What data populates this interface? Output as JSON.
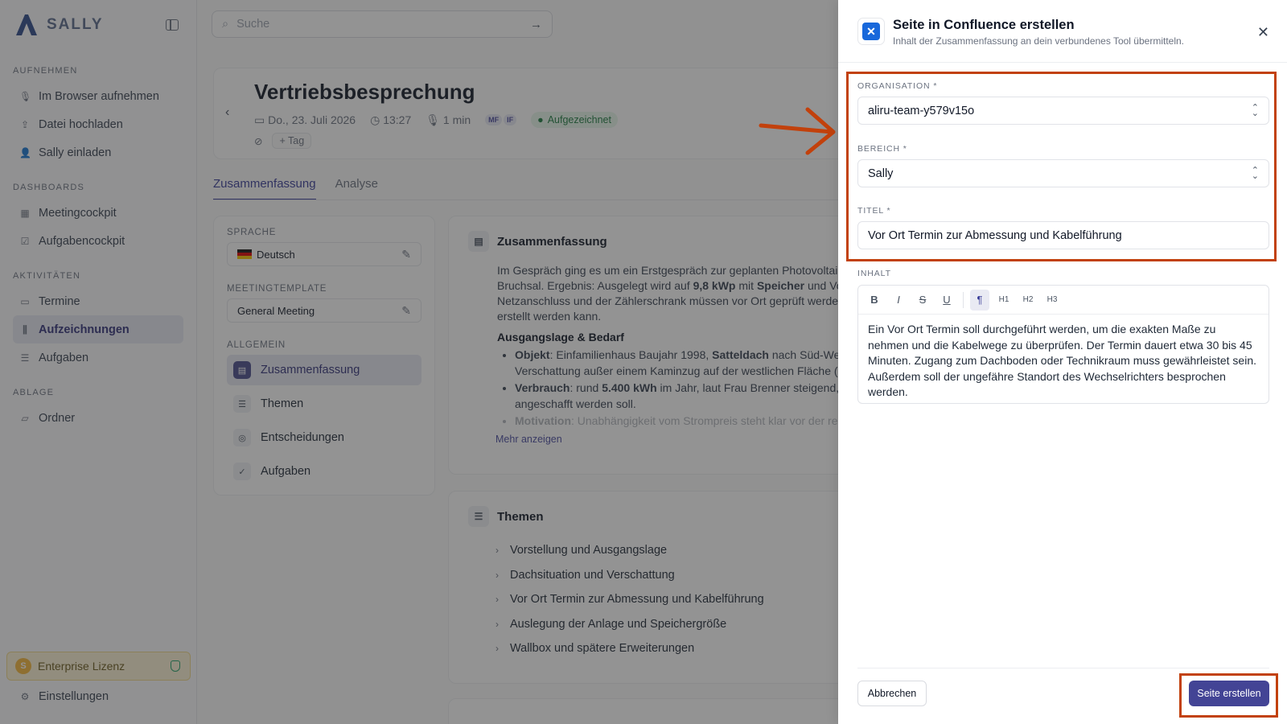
{
  "sidebar": {
    "brand": "SALLY",
    "sections": [
      {
        "title": "Aufnehmen",
        "items": [
          {
            "label": "Im Browser aufnehmen",
            "icon": "microphone-icon"
          },
          {
            "label": "Datei hochladen",
            "icon": "upload-icon"
          },
          {
            "label": "Sally einladen",
            "icon": "user-plus-icon"
          }
        ]
      },
      {
        "title": "Dashboards",
        "items": [
          {
            "label": "Meetingcockpit",
            "icon": "grid-icon"
          },
          {
            "label": "Aufgabencockpit",
            "icon": "checkbox-icon"
          }
        ]
      },
      {
        "title": "Aktivitäten",
        "items": [
          {
            "label": "Termine",
            "icon": "calendar-icon"
          },
          {
            "label": "Aufzeichnungen",
            "icon": "waveform-icon",
            "active": true
          },
          {
            "label": "Aufgaben",
            "icon": "list-check-icon"
          }
        ]
      },
      {
        "title": "Ablage",
        "items": [
          {
            "label": "Ordner",
            "icon": "folder-icon"
          }
        ]
      }
    ],
    "license_label": "Enterprise Lizenz",
    "settings_label": "Einstellungen"
  },
  "search": {
    "placeholder": "Suche"
  },
  "meeting": {
    "title": "Vertriebsbesprechung",
    "date": "Do., 23. Juli 2026",
    "time": "13:27",
    "duration": "1 min",
    "avatars": [
      "MF",
      "IF"
    ],
    "status": "Aufgezeichnet",
    "tag_button": "Tag"
  },
  "tabs": [
    "Zusammenfassung",
    "Analyse"
  ],
  "left_panel": {
    "language_label": "Sprache",
    "language_value": "Deutsch",
    "template_label": "Meetingtemplate",
    "template_value": "General Meeting",
    "general_label": "Allgemein",
    "items": [
      "Zusammenfassung",
      "Themen",
      "Entscheidungen",
      "Aufgaben"
    ]
  },
  "summary": {
    "heading": "Zusammenfassung",
    "intro_1": "Im Gespräch ging es um ein Erstgespräch zur geplanten Photovoltai",
    "intro_2a": "Bruchsal. Ergebnis: Ausgelegt wird auf ",
    "intro_2b": "9,8 kWp",
    "intro_2c": " mit ",
    "intro_2d": "Speicher",
    "intro_2e": " und Vo",
    "intro_3": "Netzanschluss und der Zählerschrank müssen vor Ort geprüft werde",
    "intro_4": "erstellt werden kann.",
    "subheading": "Ausgangslage & Bedarf",
    "b1_label": "Objekt",
    "b1_text_a": ": Einfamilienhaus Baujahr 1998, ",
    "b1_text_b": "Satteldach",
    "b1_text_c": " nach Süd-Wes",
    "b1_line2": "Verschattung außer einem Kaminzug auf der westlichen Fläche (",
    "b2_label": "Verbrauch",
    "b2_text_a": ": rund ",
    "b2_text_b": "5.400 kWh",
    "b2_text_c": " im Jahr, laut Frau Brenner steigend, ",
    "b2_line2": "angeschafft werden soll.",
    "b3_label": "Motivation",
    "b3_text": ": Unabhängigkeit vom Strompreis steht klar vor der re",
    "more": "Mehr anzeigen"
  },
  "themen": {
    "heading": "Themen",
    "items": [
      "Vorstellung und Ausgangslage",
      "Dachsituation und Verschattung",
      "Vor Ort Termin zur Abmessung und Kabelführung",
      "Auslegung der Anlage und Speichergröße",
      "Wallbox und spätere Erweiterungen"
    ]
  },
  "dialog": {
    "title": "Seite in Confluence erstellen",
    "subtitle": "Inhalt der Zusammenfassung an dein verbundenes Tool übermitteln.",
    "org_label": "Organisation *",
    "org_value": "aliru-team-y579v15o",
    "area_label": "Bereich *",
    "area_value": "Sally",
    "title_label": "Titel *",
    "title_value": "Vor Ort Termin zur Abmessung und Kabelführung",
    "content_label": "Inhalt",
    "toolbar": [
      "B",
      "I",
      "S",
      "U",
      "¶",
      "H1",
      "H2",
      "H3"
    ],
    "content_text": "Ein Vor Ort Termin soll durchgeführt werden, um die exakten Maße zu nehmen und die Kabelwege zu überprüfen. Der Termin dauert etwa 30 bis 45 Minuten. Zugang zum Dachboden oder Technikraum muss gewährleistet sein. Außerdem soll der ungefähre Standort des Wechselrichters besprochen werden.",
    "cancel": "Abbrechen",
    "submit": "Seite erstellen"
  },
  "colors": {
    "accent": "#434495",
    "annotation": "#c2410c",
    "confluence": "#1868db"
  }
}
